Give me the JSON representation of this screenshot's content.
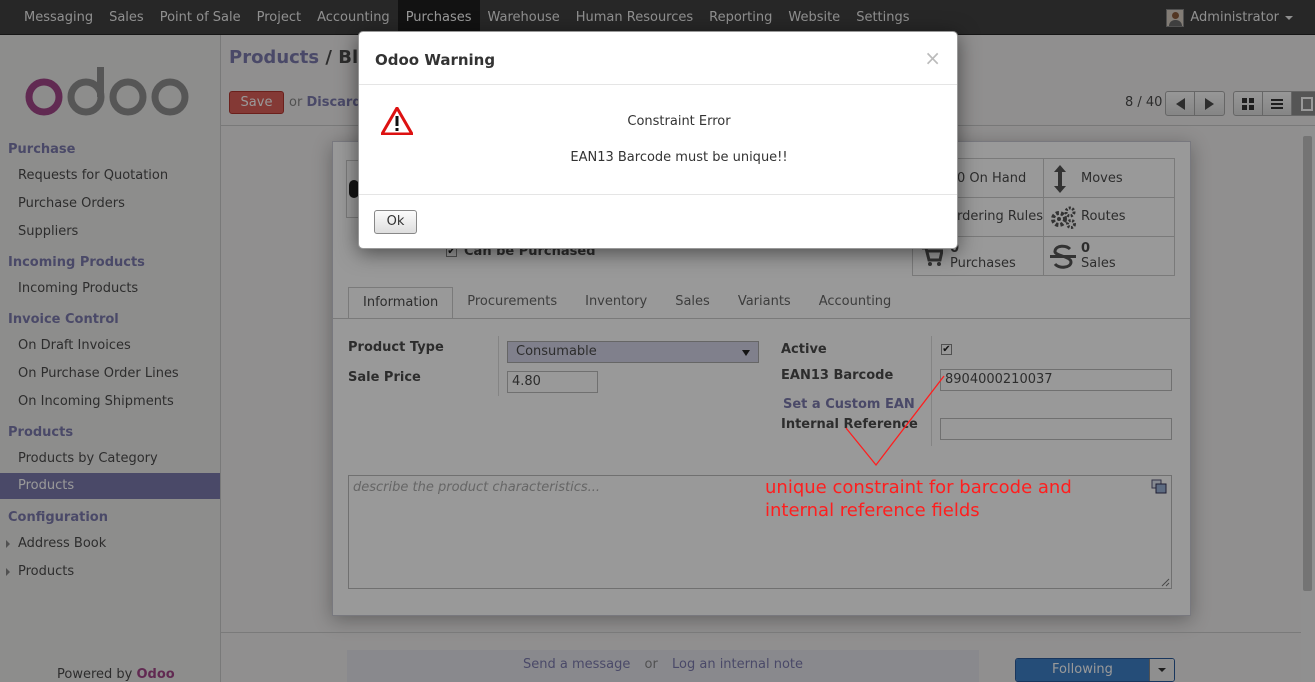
{
  "topnav": {
    "menu": [
      "Messaging",
      "Sales",
      "Point of Sale",
      "Project",
      "Accounting",
      "Purchases",
      "Warehouse",
      "Human Resources",
      "Reporting",
      "Website",
      "Settings"
    ],
    "active": "Purchases",
    "user": "Administrator"
  },
  "sidebar": {
    "sections": [
      {
        "title": "Purchase",
        "items": [
          "Requests for Quotation",
          "Purchase Orders",
          "Suppliers"
        ]
      },
      {
        "title": "Incoming Products",
        "items": [
          "Incoming Products"
        ]
      },
      {
        "title": "Invoice Control",
        "items": [
          "On Draft Invoices",
          "On Purchase Order Lines",
          "On Incoming Shipments"
        ]
      },
      {
        "title": "Products",
        "items": [
          "Products by Category",
          "Products"
        ]
      },
      {
        "title": "Configuration",
        "items": [
          "Address Book",
          "Products"
        ]
      }
    ],
    "active_item": "Products",
    "powered_by": "Powered by",
    "powered_brand": "Odoo"
  },
  "header": {
    "crumb_parent": "Products",
    "crumb_sep": " / ",
    "crumb_current": "Blac",
    "save_label": "Save",
    "or_label": "or",
    "discard_label": "Discard",
    "pager": "8 / 40"
  },
  "stats": {
    "on_hand": "0 On Hand",
    "moves": "Moves",
    "reordering": "Reordering Rules",
    "routes": "Routes",
    "purchases_count": "0",
    "purchases": "Purchases",
    "sales_count": "0",
    "sales": "Sales"
  },
  "form": {
    "can_be_purchased": "Can be Purchased",
    "tabs": [
      "Information",
      "Procurements",
      "Inventory",
      "Sales",
      "Variants",
      "Accounting"
    ],
    "active_tab": "Information",
    "product_type_label": "Product Type",
    "product_type_value": "Consumable",
    "sale_price_label": "Sale Price",
    "sale_price_value": "4.80",
    "active_label": "Active",
    "ean_label": "EAN13 Barcode",
    "ean_value": "8904000210037",
    "custom_ean_link": "Set a Custom EAN",
    "internal_ref_label": "Internal Reference",
    "internal_ref_value": "",
    "description_placeholder": "describe the product characteristics..."
  },
  "annotation": {
    "line1": "unique constraint for barcode and",
    "line2": "internal reference fields",
    "color": "#ff1e1e"
  },
  "chatter": {
    "send_message": "Send a message",
    "or": "or",
    "log_note": "Log an internal note",
    "following": "Following"
  },
  "modal": {
    "title": "Odoo Warning",
    "close": "×",
    "error_title": "Constraint Error",
    "error_message": "EAN13 Barcode must be unique!!",
    "ok_label": "Ok"
  },
  "colors": {
    "accent": "#7c7bad",
    "save": "#dc5f59",
    "brand": "#a24689",
    "following": "#3f80c8"
  }
}
